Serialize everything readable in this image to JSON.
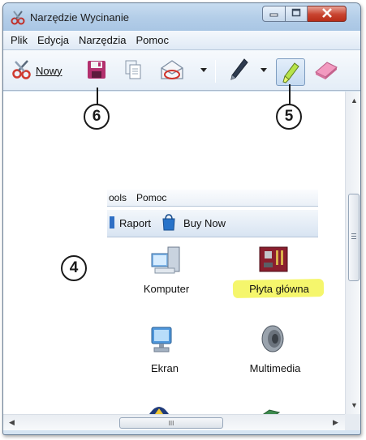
{
  "window": {
    "title": "Narzędzie Wycinanie",
    "controls": [
      "minimize-icon",
      "maximize-icon",
      "close-icon"
    ]
  },
  "menubar": {
    "items": [
      {
        "label": "Plik"
      },
      {
        "label": "Edycja"
      },
      {
        "label": "Narzędzia"
      },
      {
        "label": "Pomoc"
      }
    ]
  },
  "toolbar": {
    "new_label": "Nowy",
    "icons": [
      "scissors-icon",
      "save-icon",
      "copy-icon",
      "email-icon",
      "pen-icon",
      "highlighter-icon",
      "eraser-icon"
    ]
  },
  "captured": {
    "menu_fragment": "ools",
    "menu_help": "Pomoc",
    "report_label": "Raport",
    "buy_label": "Buy Now",
    "items": [
      {
        "label": "Komputer",
        "icon": "computer-icon"
      },
      {
        "label": "Płyta główna",
        "icon": "motherboard-icon"
      },
      {
        "label": "Ekran",
        "icon": "monitor-icon"
      },
      {
        "label": "Multimedia",
        "icon": "speaker-icon"
      }
    ],
    "highlight_color": "#f3f552"
  },
  "callouts": {
    "c4": "4",
    "c5": "5",
    "c6": "6"
  },
  "scrollbar": {
    "thumb_glyph": "III"
  }
}
